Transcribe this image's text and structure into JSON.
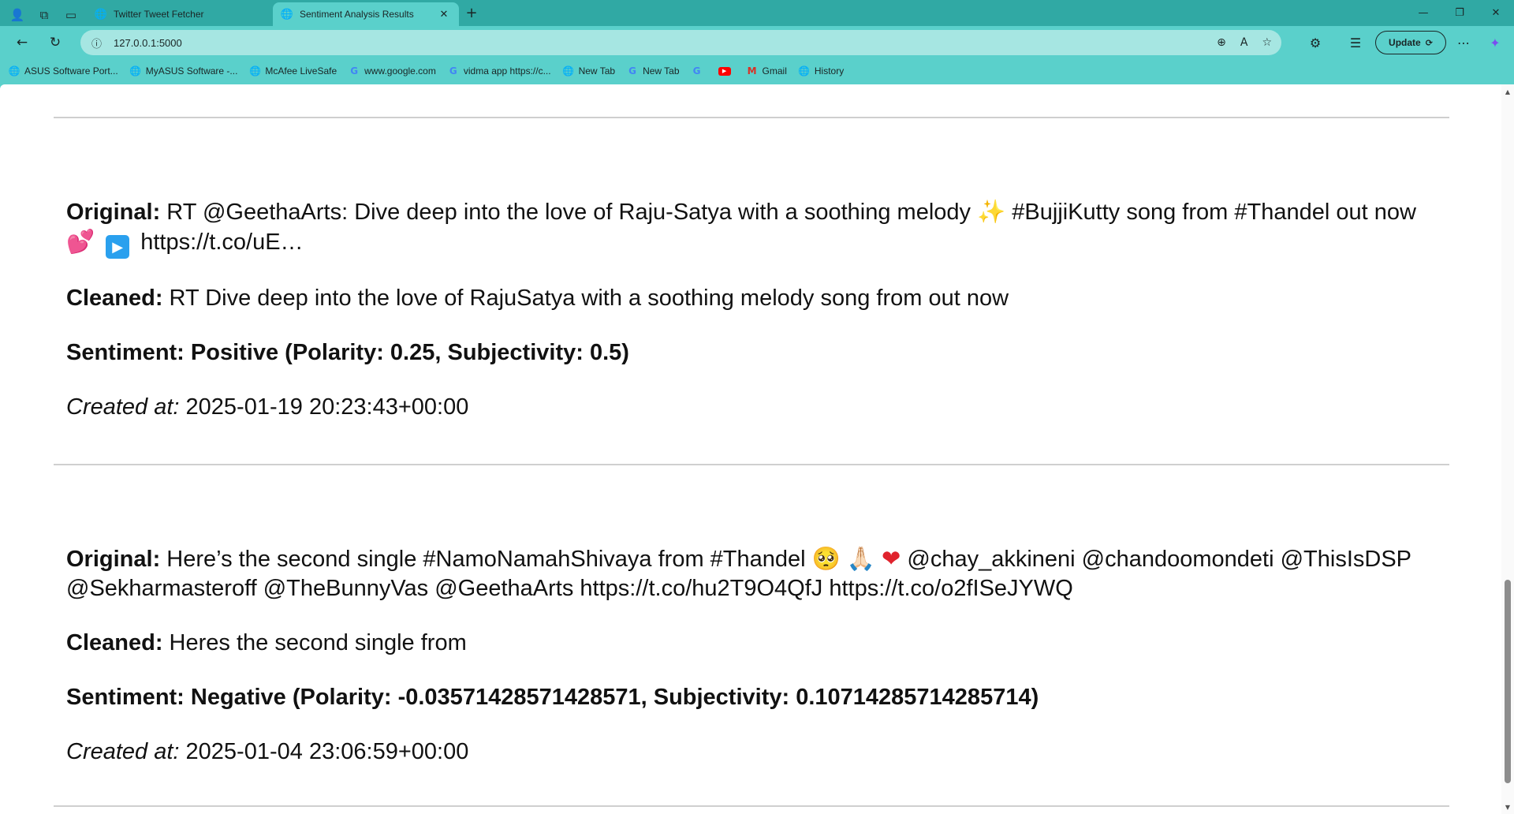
{
  "window": {
    "tabs": [
      {
        "title": "Twitter Tweet Fetcher",
        "active": false
      },
      {
        "title": "Sentiment Analysis Results",
        "active": true
      }
    ],
    "controls": {
      "minimize": "—",
      "restore": "❐",
      "close": "✕"
    }
  },
  "addressbar": {
    "url": "127.0.0.1:5000",
    "update_label": "Update"
  },
  "bookmarks": [
    {
      "label": "ASUS Software Port...",
      "icon": "globe-icon"
    },
    {
      "label": "MyASUS Software -...",
      "icon": "globe-icon"
    },
    {
      "label": "McAfee LiveSafe",
      "icon": "globe-icon"
    },
    {
      "label": "www.google.com",
      "icon": "google-icon"
    },
    {
      "label": "vidma app https://c...",
      "icon": "google-icon"
    },
    {
      "label": "New Tab",
      "icon": "globe-icon"
    },
    {
      "label": "New Tab",
      "icon": "google-icon"
    },
    {
      "label": "",
      "icon": "google-icon"
    },
    {
      "label": "",
      "icon": "youtube-icon"
    },
    {
      "label": "Gmail",
      "icon": "gmail-icon"
    },
    {
      "label": "History",
      "icon": "globe-icon"
    }
  ],
  "results": [
    {
      "original_label": "Original:",
      "original_text_1": "RT @GeethaArts: Dive deep into the love of Raju-Satya with a soothing melody",
      "original_emoji_1": "✨",
      "original_text_2": "#BujjiKutty song from #Thandel out now",
      "original_emoji_2": "💕",
      "original_emoji_3": "▶",
      "original_text_3": "https://t.co/uE…",
      "cleaned_label": "Cleaned:",
      "cleaned_text": "RT Dive deep into the love of RajuSatya with a soothing melody song from out now",
      "sentiment_text": "Sentiment: Positive (Polarity: 0.25, Subjectivity: 0.5)",
      "created_label": "Created at:",
      "created_value": "2025-01-19 20:23:43+00:00"
    },
    {
      "original_label": "Original:",
      "original_text_1": "Here’s the second single #NamoNamahShivaya from #Thandel",
      "original_emoji_1": "🥺",
      "original_emoji_2": "🙏🏻",
      "original_emoji_3": "❤",
      "original_text_2": "@chay_akkineni @chandoomondeti @ThisIsDSP @Sekharmasteroff @TheBunnyVas @GeethaArts https://t.co/hu2T9O4QfJ https://t.co/o2fISeJYWQ",
      "cleaned_label": "Cleaned:",
      "cleaned_text": "Heres the second single from",
      "sentiment_text": "Sentiment: Negative (Polarity: -0.03571428571428571, Subjectivity: 0.10714285714285714)",
      "created_label": "Created at:",
      "created_value": "2025-01-04 23:06:59+00:00"
    }
  ],
  "colors": {
    "titlebar": "#30a9a4",
    "toolbar": "#5ad0cb",
    "omnibox": "#a6e6e2",
    "page_bg": "#ffffff"
  }
}
